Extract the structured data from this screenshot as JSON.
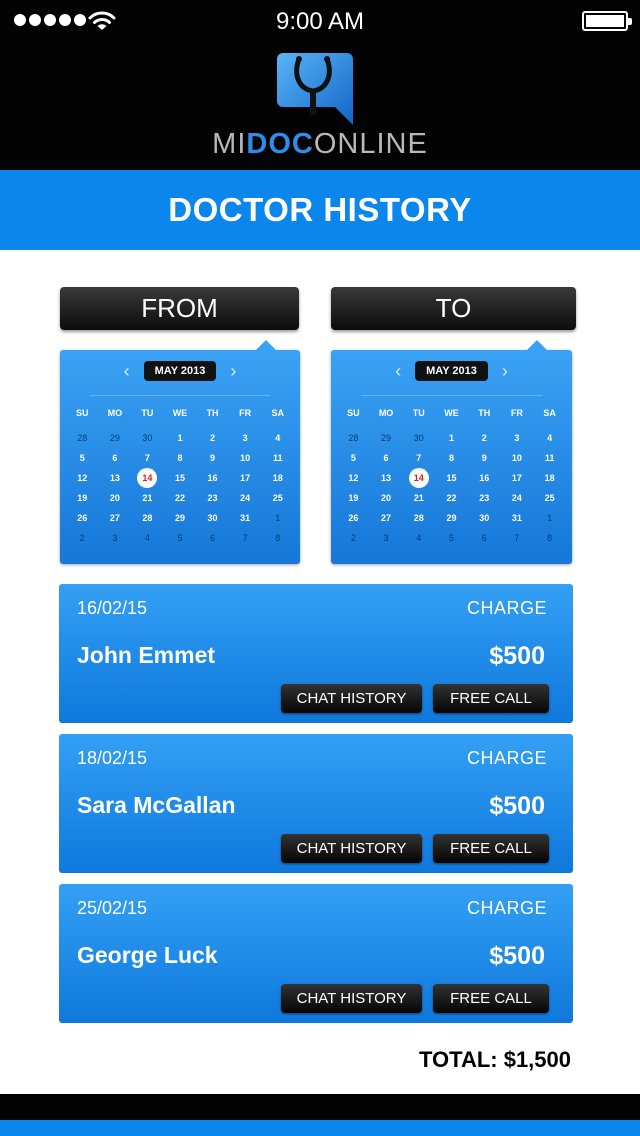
{
  "status_bar": {
    "time": "9:00 AM"
  },
  "logo": {
    "part1": "MI",
    "part2": "DOC",
    "part3": "ONLINE"
  },
  "page_title": "DOCTOR HISTORY",
  "range": {
    "from_label": "FROM",
    "to_label": "TO",
    "from_calendar": {
      "month": "MAY 2013",
      "weekdays": [
        "SU",
        "MO",
        "TU",
        "WE",
        "TH",
        "FR",
        "SA"
      ],
      "today": "14",
      "days": [
        [
          "28",
          "29",
          "30",
          "1",
          "2",
          "3",
          "4"
        ],
        [
          "5",
          "6",
          "7",
          "8",
          "9",
          "10",
          "11"
        ],
        [
          "12",
          "13",
          "14",
          "15",
          "16",
          "17",
          "18"
        ],
        [
          "19",
          "20",
          "21",
          "22",
          "23",
          "24",
          "25"
        ],
        [
          "26",
          "27",
          "28",
          "29",
          "30",
          "31",
          "1"
        ],
        [
          "2",
          "3",
          "4",
          "5",
          "6",
          "7",
          "8"
        ]
      ]
    },
    "to_calendar": {
      "month": "MAY 2013",
      "weekdays": [
        "SU",
        "MO",
        "TU",
        "WE",
        "TH",
        "FR",
        "SA"
      ],
      "today": "14",
      "days": [
        [
          "28",
          "29",
          "30",
          "1",
          "2",
          "3",
          "4"
        ],
        [
          "5",
          "6",
          "7",
          "8",
          "9",
          "10",
          "11"
        ],
        [
          "12",
          "13",
          "14",
          "15",
          "16",
          "17",
          "18"
        ],
        [
          "19",
          "20",
          "21",
          "22",
          "23",
          "24",
          "25"
        ],
        [
          "26",
          "27",
          "28",
          "29",
          "30",
          "31",
          "1"
        ],
        [
          "2",
          "3",
          "4",
          "5",
          "6",
          "7",
          "8"
        ]
      ]
    }
  },
  "history": [
    {
      "date": "16/02/15",
      "charge_label": "CHARGE",
      "doctor": "John Emmet",
      "amount": "$500",
      "chat_label": "CHAT HISTORY",
      "call_label": "FREE CALL"
    },
    {
      "date": "18/02/15",
      "charge_label": "CHARGE",
      "doctor": "Sara McGallan",
      "amount": "$500",
      "chat_label": "CHAT HISTORY",
      "call_label": "FREE CALL"
    },
    {
      "date": "25/02/15",
      "charge_label": "CHARGE",
      "doctor": "George Luck",
      "amount": "$500",
      "chat_label": "CHAT HISTORY",
      "call_label": "FREE CALL"
    }
  ],
  "total": "TOTAL: $1,500",
  "colors": {
    "brand_blue": "#0a86ec",
    "header_black": "#030303",
    "today_red": "#d42020"
  },
  "icons": [
    "signal-icon",
    "wifi-icon",
    "battery-icon",
    "stethoscope-logo-icon",
    "chevron-left-icon",
    "chevron-right-icon"
  ]
}
